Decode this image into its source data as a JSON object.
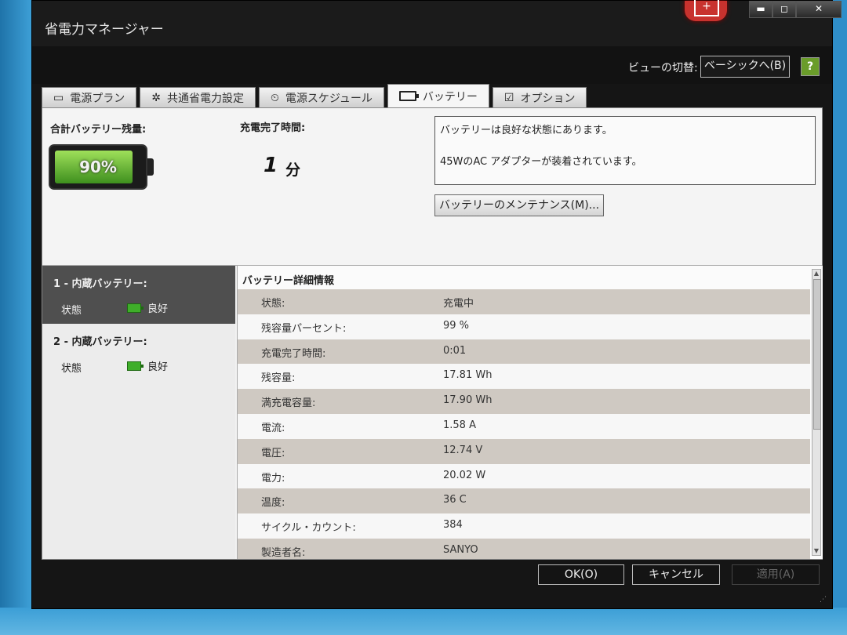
{
  "window": {
    "title": "省電力マネージャー",
    "app_icon": "battery-plus-icon",
    "min_glyph": "▬",
    "max_glyph": "◻",
    "close_glyph": "✕"
  },
  "viewbar": {
    "label": "ビューの切替:",
    "switch_button": "ベーシックへ(B)",
    "help_glyph": "?"
  },
  "tabs": [
    {
      "label": "電源プラン",
      "icon": "plug-icon",
      "glyph": "▭"
    },
    {
      "label": "共通省電力設定",
      "icon": "gear-icon",
      "glyph": "✲"
    },
    {
      "label": "電源スケジュール",
      "icon": "schedule-icon",
      "glyph": "⏲"
    },
    {
      "label": "バッテリー",
      "icon": "battery-icon",
      "glyph": ""
    },
    {
      "label": "オプション",
      "icon": "checkbox-icon",
      "glyph": "☑"
    }
  ],
  "active_tab": 3,
  "summary": {
    "total_label": "合計バッテリー残量:",
    "total_percent": "90%",
    "fill_fraction": 0.9,
    "charge_label": "充電完了時間:",
    "charge_value": "1",
    "charge_unit": "分",
    "message_line1": "バッテリーは良好な状態にあります。",
    "message_line2": "45WのAC アダプターが装着されています。",
    "maintenance_button": "バッテリーのメンテナンス(M)..."
  },
  "batteries": [
    {
      "name": "1 - 内蔵バッテリー:",
      "status_label": "状態",
      "status_value": "良好"
    },
    {
      "name": "2 - 内蔵バッテリー:",
      "status_label": "状態",
      "status_value": "良好"
    }
  ],
  "details": {
    "title": "バッテリー詳細情報",
    "rows": [
      {
        "key": "状態:",
        "value": "充電中"
      },
      {
        "key": "残容量パーセント:",
        "value": "99 %"
      },
      {
        "key": "充電完了時間:",
        "value": "0:01"
      },
      {
        "key": "残容量:",
        "value": "17.81 Wh"
      },
      {
        "key": "満充電容量:",
        "value": "17.90 Wh"
      },
      {
        "key": "電流:",
        "value": "1.58 A"
      },
      {
        "key": "電圧:",
        "value": "12.74 V"
      },
      {
        "key": "電力:",
        "value": "20.02 W"
      },
      {
        "key": "温度:",
        "value": "36 C"
      },
      {
        "key": "サイクル・カウント:",
        "value": "384"
      },
      {
        "key": "製造者名:",
        "value": "SANYO"
      }
    ]
  },
  "footer": {
    "ok": "OK(O)",
    "cancel": "キャンセル",
    "apply": "適用(A)"
  }
}
